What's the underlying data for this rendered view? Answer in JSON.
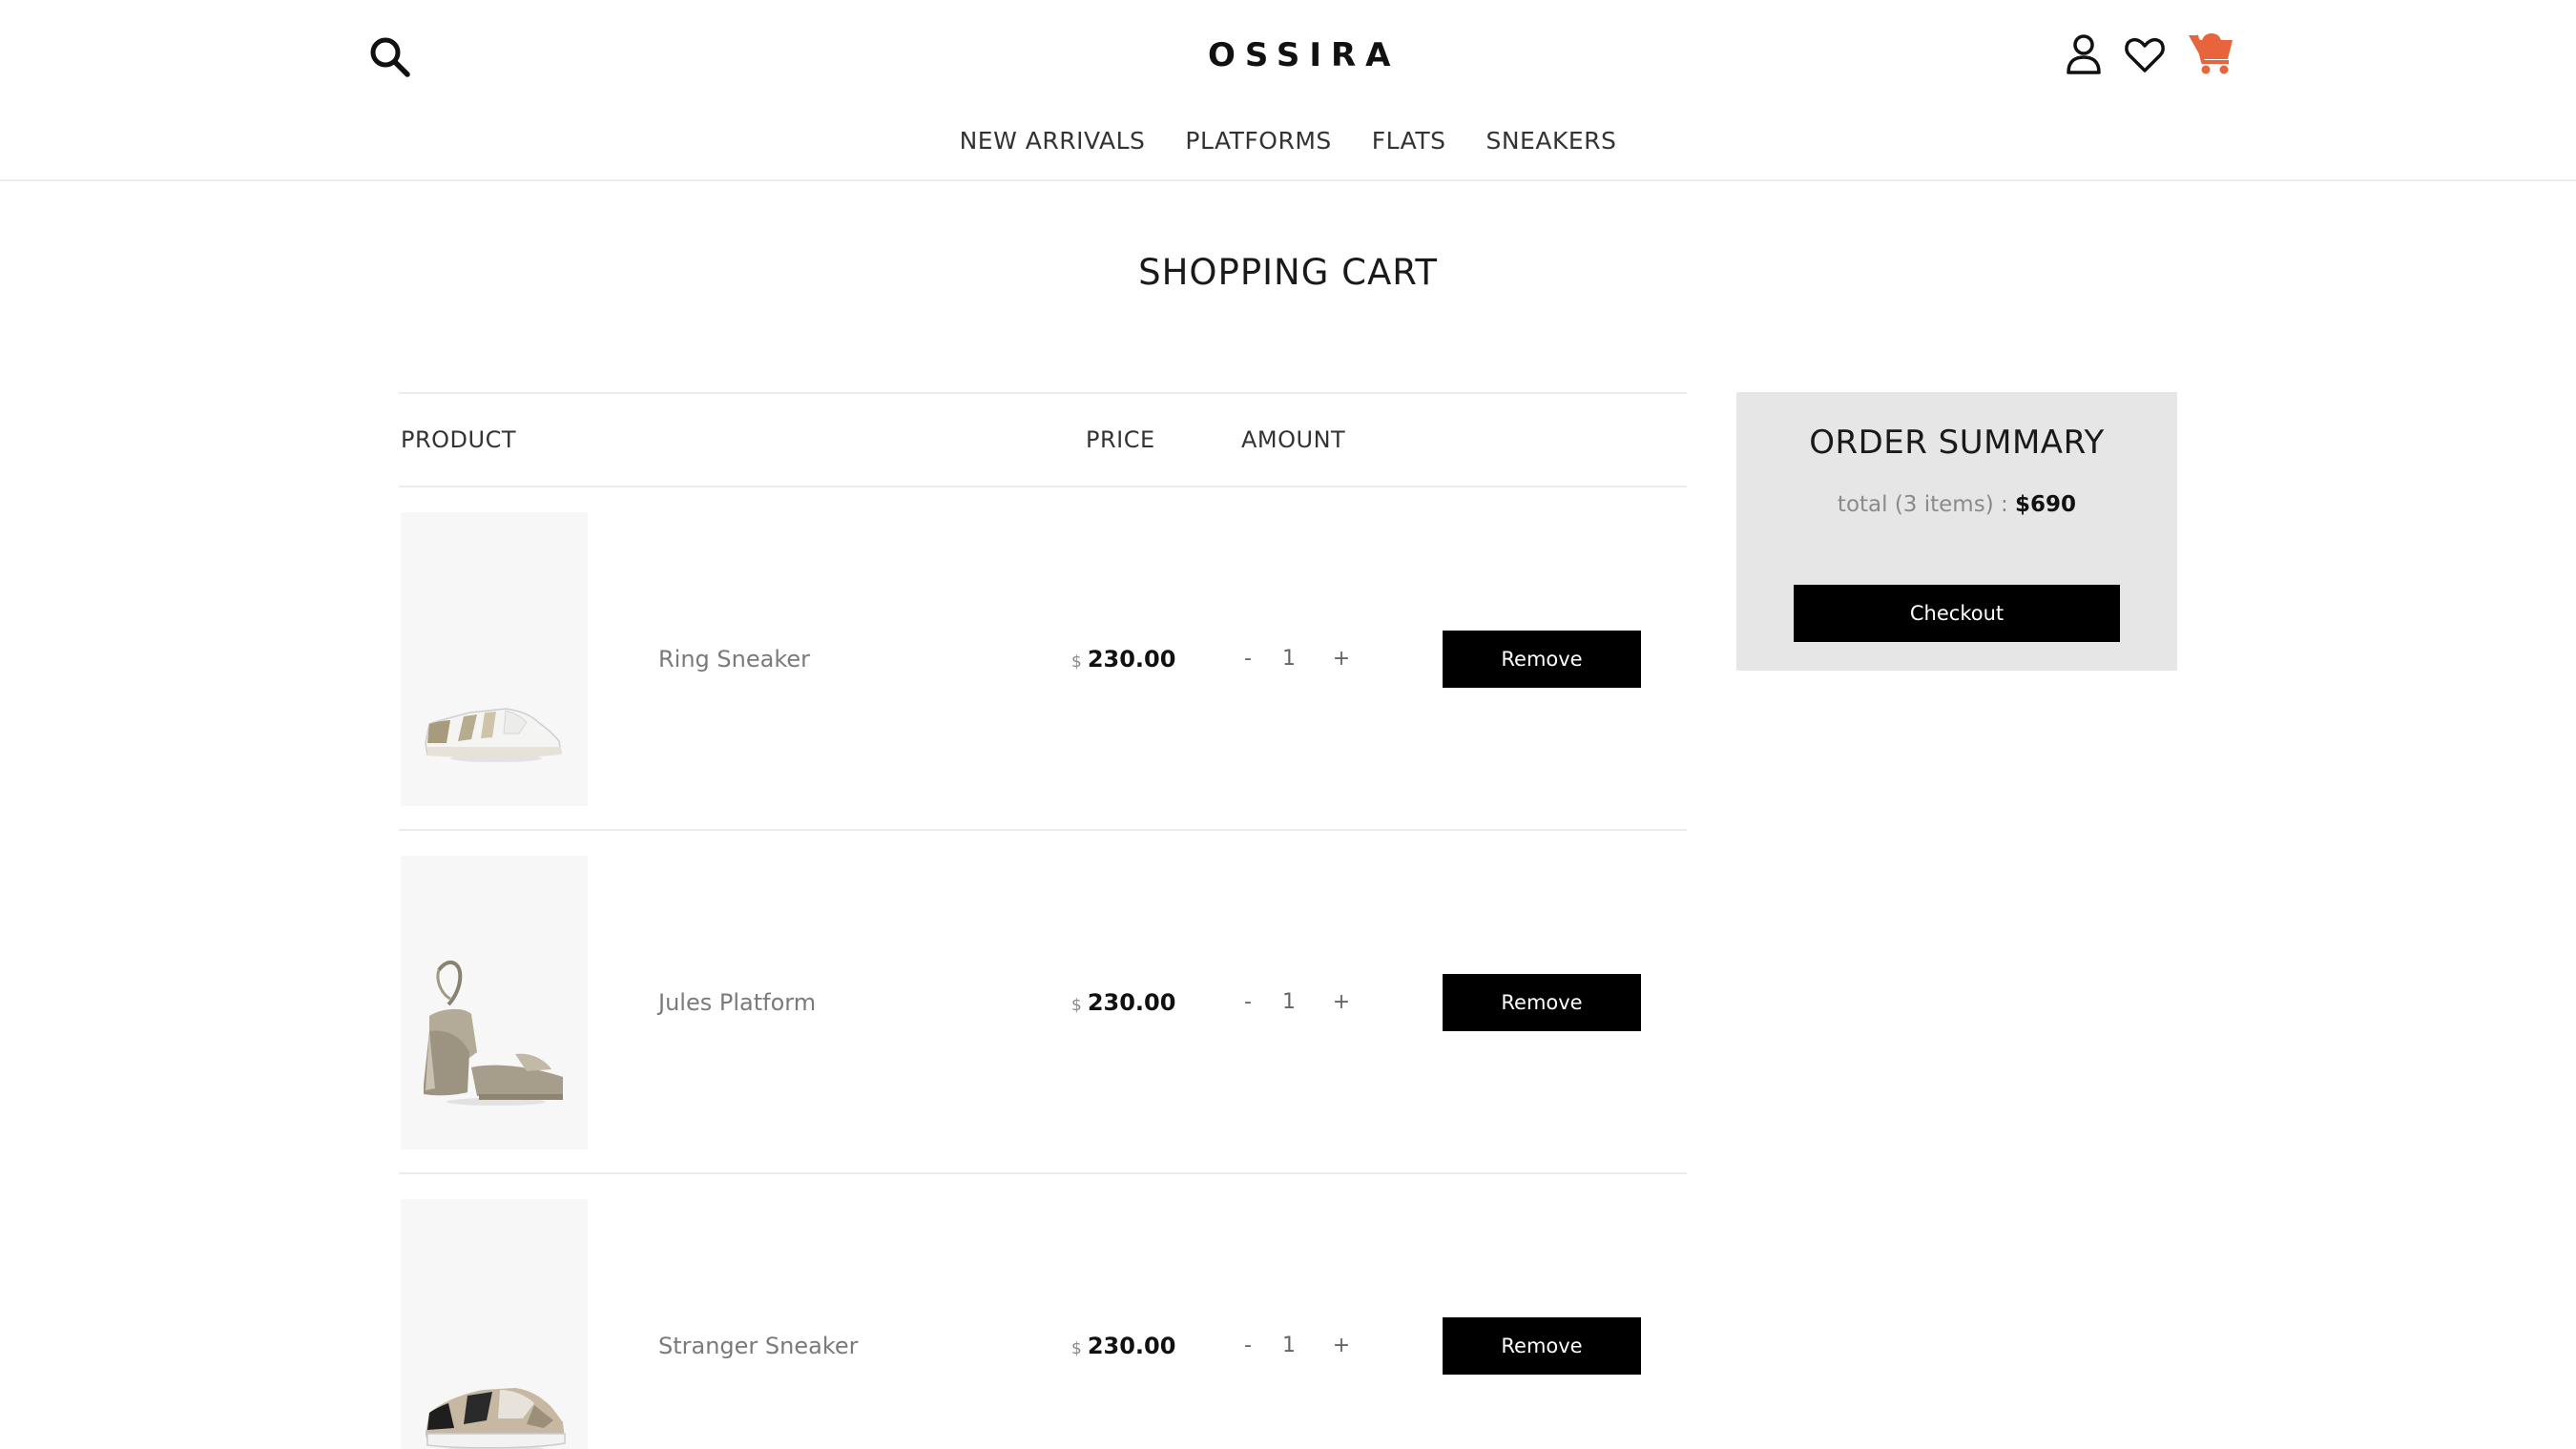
{
  "header": {
    "logo": "OSSIRA",
    "nav": [
      "NEW ARRIVALS",
      "PLATFORMS",
      "FLATS",
      "SNEAKERS"
    ],
    "cart_icon_color": "#e8643c"
  },
  "page_title": "SHOPPING CART",
  "table": {
    "columns": {
      "product": "PRODUCT",
      "price": "PRICE",
      "amount": "AMOUNT"
    },
    "items": [
      {
        "name": "Ring Sneaker",
        "currency": "$",
        "price": "230.00",
        "minus": "-",
        "quantity": "1",
        "plus": "+",
        "remove": "Remove"
      },
      {
        "name": "Jules Platform",
        "currency": "$",
        "price": "230.00",
        "minus": "-",
        "quantity": "1",
        "plus": "+",
        "remove": "Remove"
      },
      {
        "name": "Stranger Sneaker",
        "currency": "$",
        "price": "230.00",
        "minus": "-",
        "quantity": "1",
        "plus": "+",
        "remove": "Remove"
      }
    ]
  },
  "summary": {
    "title": "ORDER SUMMARY",
    "total_label": "total (3 items) :",
    "total_value": "$690",
    "checkout": "Checkout"
  }
}
